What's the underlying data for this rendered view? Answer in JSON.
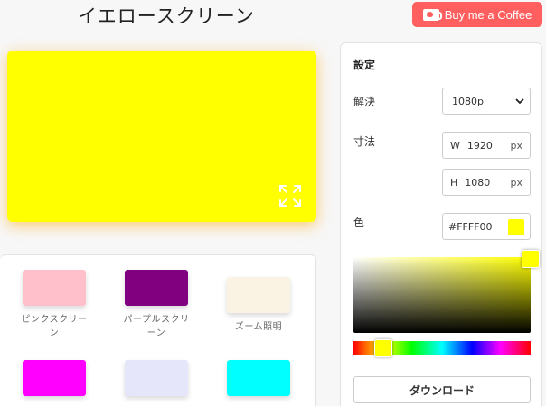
{
  "header": {
    "title": "イエロースクリーン",
    "coffee_label": "Buy me a Coffee",
    "coffee_color": "#ff5f5f"
  },
  "preview": {
    "color": "#FFFF00",
    "fullscreen_icon": "fullscreen-expand-icon"
  },
  "swatches": [
    {
      "label": "ピンクスクリーン",
      "color": "#FFC0CB"
    },
    {
      "label": "パープルスクリーン",
      "color": "#800080"
    },
    {
      "label": "ズーム照明",
      "color": "#FAF3E4"
    },
    {
      "label": "",
      "color": "#FF00FF"
    },
    {
      "label": "",
      "color": "#E6E6FA"
    },
    {
      "label": "",
      "color": "#00FFFF"
    }
  ],
  "settings": {
    "title": "設定",
    "resolution_label": "解決",
    "resolution_value": "1080p",
    "dimension_label": "寸法",
    "width_prefix": "W",
    "width_value": "1920",
    "height_prefix": "H",
    "height_value": "1080",
    "unit": "px",
    "color_label": "色",
    "color_value": "#FFFF00",
    "hue_position": 0.17,
    "download_label": "ダウンロード"
  }
}
